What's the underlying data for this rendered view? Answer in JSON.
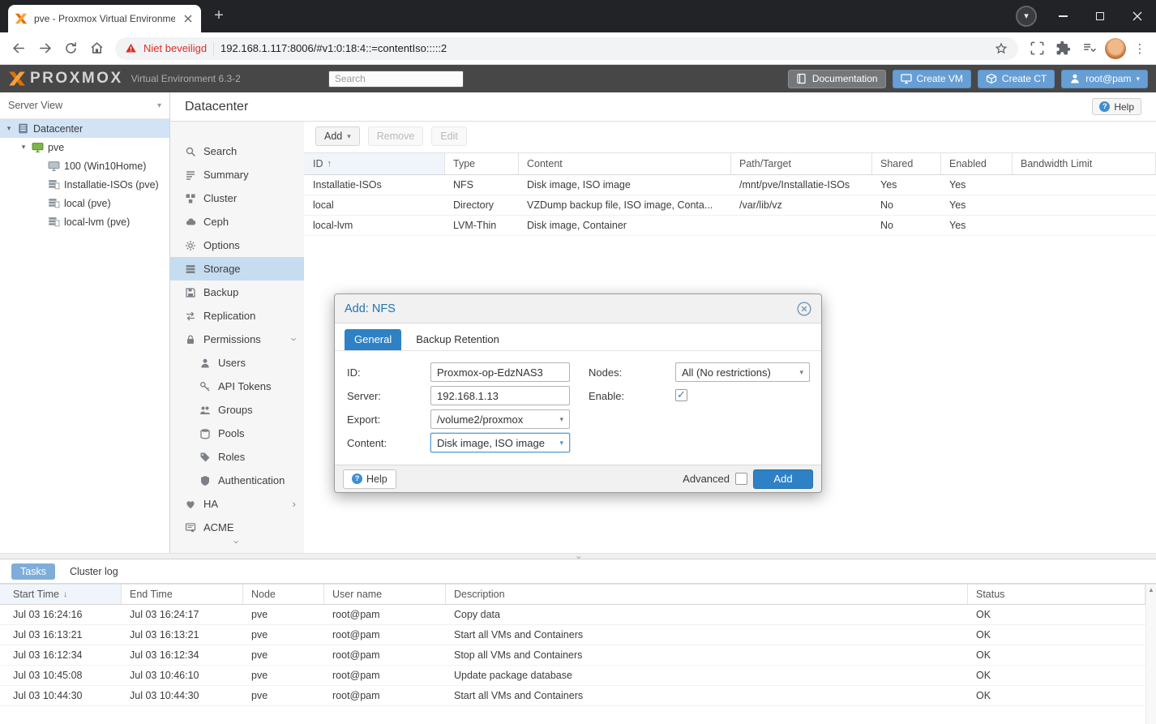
{
  "colors": {
    "accent_blue": "#2e81c4",
    "light_blue_button": "#679fd5",
    "header_gray": "#474747",
    "brand_orange": "#e57000",
    "warning_red": "#d93025",
    "selection_blue": "#c6dcf1"
  },
  "browser": {
    "tab_title": "pve - Proxmox Virtual Environme",
    "security_label": "Niet beveiligd",
    "url": "192.168.1.117:8006/#v1:0:18:4::=contentIso:::::2"
  },
  "header": {
    "logo_text": "PROXMOX",
    "subtitle": "Virtual Environment 6.3-2",
    "search_placeholder": "Search",
    "documentation_label": "Documentation",
    "create_vm_label": "Create VM",
    "create_ct_label": "Create CT",
    "user_label": "root@pam"
  },
  "tree": {
    "view_label": "Server View",
    "items": [
      {
        "label": "Datacenter",
        "icon": "datacenter-icon",
        "level": 0,
        "selected": true,
        "expanded": true
      },
      {
        "label": "pve",
        "icon": "node-icon",
        "level": 1,
        "expanded": true
      },
      {
        "label": "100 (Win10Home)",
        "icon": "vm-icon",
        "level": 2
      },
      {
        "label": "Installatie-ISOs (pve)",
        "icon": "tree-storage-icon",
        "level": 2
      },
      {
        "label": "local (pve)",
        "icon": "tree-storage-icon",
        "level": 2
      },
      {
        "label": "local-lvm (pve)",
        "icon": "tree-storage-icon",
        "level": 2
      }
    ]
  },
  "nav": {
    "items": [
      {
        "label": "Search",
        "icon": "search-icon"
      },
      {
        "label": "Summary",
        "icon": "summary-icon"
      },
      {
        "label": "Cluster",
        "icon": "cluster-icon"
      },
      {
        "label": "Ceph",
        "icon": "ceph-icon"
      },
      {
        "label": "Options",
        "icon": "gear-icon"
      },
      {
        "label": "Storage",
        "icon": "storage-icon",
        "selected": true
      },
      {
        "label": "Backup",
        "icon": "backup-icon"
      },
      {
        "label": "Replication",
        "icon": "replication-icon"
      },
      {
        "label": "Permissions",
        "icon": "permissions-icon",
        "chevron": "down"
      },
      {
        "label": "Users",
        "icon": "user-icon",
        "indent": true
      },
      {
        "label": "API Tokens",
        "icon": "token-icon",
        "indent": true
      },
      {
        "label": "Groups",
        "icon": "groups-icon",
        "indent": true
      },
      {
        "label": "Pools",
        "icon": "pools-icon",
        "indent": true
      },
      {
        "label": "Roles",
        "icon": "roles-icon",
        "indent": true
      },
      {
        "label": "Authentication",
        "icon": "auth-icon",
        "indent": true
      },
      {
        "label": "HA",
        "icon": "ha-icon",
        "chevron": "right"
      },
      {
        "label": "ACME",
        "icon": "acme-icon"
      }
    ]
  },
  "content": {
    "title": "Datacenter",
    "help_label": "Help",
    "toolbar": {
      "add_label": "Add",
      "remove_label": "Remove",
      "edit_label": "Edit"
    },
    "storage_table": {
      "columns": [
        {
          "label": "ID",
          "sorted": "asc"
        },
        {
          "label": "Type"
        },
        {
          "label": "Content"
        },
        {
          "label": "Path/Target"
        },
        {
          "label": "Shared"
        },
        {
          "label": "Enabled"
        },
        {
          "label": "Bandwidth Limit"
        }
      ],
      "rows": [
        [
          "Installatie-ISOs",
          "NFS",
          "Disk image, ISO image",
          "/mnt/pve/Installatie-ISOs",
          "Yes",
          "Yes",
          ""
        ],
        [
          "local",
          "Directory",
          "VZDump backup file, ISO image, Conta...",
          "/var/lib/vz",
          "No",
          "Yes",
          ""
        ],
        [
          "local-lvm",
          "LVM-Thin",
          "Disk image, Container",
          "",
          "No",
          "Yes",
          ""
        ]
      ]
    }
  },
  "dialog": {
    "title": "Add: NFS",
    "tabs": [
      "General",
      "Backup Retention"
    ],
    "active_tab": "General",
    "fields": {
      "id_label": "ID:",
      "id_value": "Proxmox-op-EdzNAS3",
      "server_label": "Server:",
      "server_value": "192.168.1.13",
      "export_label": "Export:",
      "export_value": "/volume2/proxmox",
      "content_label": "Content:",
      "content_value": "Disk image, ISO image",
      "nodes_label": "Nodes:",
      "nodes_value": "All (No restrictions)",
      "enable_label": "Enable:",
      "enable_checked": true
    },
    "footer": {
      "help_label": "Help",
      "advanced_label": "Advanced",
      "advanced_checked": false,
      "add_label": "Add"
    }
  },
  "tasks": {
    "tabs": [
      {
        "label": "Tasks",
        "active": true
      },
      {
        "label": "Cluster log",
        "active": false
      }
    ],
    "columns": [
      {
        "label": "Start Time",
        "sorted": "desc"
      },
      {
        "label": "End Time"
      },
      {
        "label": "Node"
      },
      {
        "label": "User name"
      },
      {
        "label": "Description"
      },
      {
        "label": "Status"
      }
    ],
    "rows": [
      [
        "Jul 03 16:24:16",
        "Jul 03 16:24:17",
        "pve",
        "root@pam",
        "Copy data",
        "OK"
      ],
      [
        "Jul 03 16:13:21",
        "Jul 03 16:13:21",
        "pve",
        "root@pam",
        "Start all VMs and Containers",
        "OK"
      ],
      [
        "Jul 03 16:12:34",
        "Jul 03 16:12:34",
        "pve",
        "root@pam",
        "Stop all VMs and Containers",
        "OK"
      ],
      [
        "Jul 03 10:45:08",
        "Jul 03 10:46:10",
        "pve",
        "root@pam",
        "Update package database",
        "OK"
      ],
      [
        "Jul 03 10:44:30",
        "Jul 03 10:44:30",
        "pve",
        "root@pam",
        "Start all VMs and Containers",
        "OK"
      ]
    ]
  }
}
